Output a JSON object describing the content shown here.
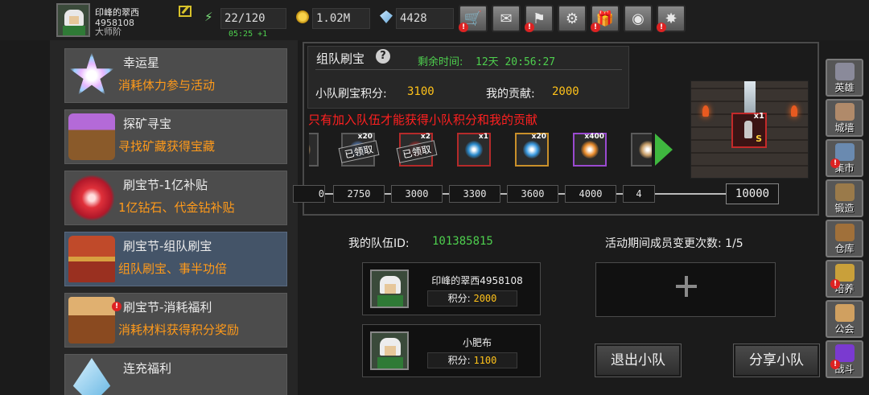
{
  "player": {
    "name": "印峰的翠西",
    "id": "4958108",
    "rank": "大师阶"
  },
  "resources": {
    "energy": "22/120",
    "energy_timer": "05:25 +1",
    "gold": "1.02M",
    "gems": "4428"
  },
  "top_buttons": [
    {
      "icon": "shop-cart-icon",
      "glyph": "🛒",
      "badge": true
    },
    {
      "icon": "mail-icon",
      "glyph": "✉",
      "badge": false
    },
    {
      "icon": "pennant-icon",
      "glyph": "⚑",
      "badge": true
    },
    {
      "icon": "gear-icon",
      "glyph": "⚙",
      "badge": false
    },
    {
      "icon": "gift-icon",
      "glyph": "🎁",
      "badge": true
    },
    {
      "icon": "color-wheel-icon",
      "glyph": "◉",
      "badge": false
    },
    {
      "icon": "fireworks-icon",
      "glyph": "✸",
      "badge": true
    }
  ],
  "menu": {
    "items": [
      {
        "title": "幸运星",
        "subtitle": "消耗体力参与活动",
        "icon": "lucky-star-icon",
        "active": false,
        "badge": false
      },
      {
        "title": "探矿寻宝",
        "subtitle": "寻找矿藏获得宝藏",
        "icon": "mining-cart-icon",
        "active": false,
        "badge": false
      },
      {
        "title": "刷宝节-1亿补贴",
        "subtitle": "1亿钻石、代金钻补贴",
        "icon": "red-flower-icon",
        "active": false,
        "badge": false
      },
      {
        "title": "刷宝节-组队刷宝",
        "subtitle": "组队刷宝、事半功倍",
        "icon": "treasure-chest-icon",
        "active": true,
        "badge": false
      },
      {
        "title": "刷宝节-消耗福利",
        "subtitle": "消耗材料获得积分奖励",
        "icon": "open-chest-icon",
        "active": false,
        "badge": true
      },
      {
        "title": "连充福利",
        "subtitle": "",
        "icon": "crystal-icon",
        "active": false,
        "badge": false
      }
    ]
  },
  "event": {
    "title": "组队刷宝",
    "help": "?",
    "remaining_label": "剩余时间:",
    "remaining_value": "12天 20:56:27",
    "team_score_label": "小队刷宝积分:",
    "team_score_value": "3100",
    "my_contribution_label": "我的贡献:",
    "my_contribution_value": "2000",
    "notice": "只有加入队伍才能获得小队积分和我的贡献",
    "claimed_text": "已领取",
    "rewards": [
      {
        "icon": "partial-item-icon",
        "qty": "",
        "claimed": true,
        "color": "#c9a06a"
      },
      {
        "icon": "dark-gem-icon",
        "qty": "x20",
        "claimed": true,
        "color": "#4a6a9a"
      },
      {
        "icon": "red-rune-icon",
        "qty": "x2",
        "claimed": true,
        "color": "#8a2a2a"
      },
      {
        "icon": "blue-orb-icon",
        "qty": "x1",
        "claimed": false,
        "color": "#2a8acc"
      },
      {
        "icon": "lightning-scroll-icon",
        "qty": "x20",
        "claimed": false,
        "color": "#3a9ae0"
      },
      {
        "icon": "fire-potion-icon",
        "qty": "x400",
        "claimed": false,
        "color": "#e88a2a"
      },
      {
        "icon": "partial-item-icon",
        "qty": "",
        "claimed": false,
        "color": "#c9a06a"
      }
    ],
    "milestones": [
      "0",
      "2750",
      "3000",
      "3300",
      "3600",
      "4000",
      "4"
    ],
    "milestone_final": "10000",
    "preview_item_qty": "x1",
    "preview_item_rarity": "S"
  },
  "team": {
    "id_label": "我的队伍ID:",
    "id_value": "101385815",
    "changes_label": "活动期间成员变更次数:",
    "changes_value": "1/5",
    "score_label": "积分:",
    "members": [
      {
        "name": "印峰的翠西4958108",
        "score": "2000"
      },
      {
        "name": "小肥布",
        "score": "1100"
      }
    ],
    "leave_button": "退出小队",
    "share_button": "分享小队"
  },
  "sidebar": [
    {
      "label": "英雄",
      "icon": "helmet-icon",
      "color": "#8a8a9a",
      "badge": false
    },
    {
      "label": "城墙",
      "icon": "castle-wall-icon",
      "color": "#b08a6a",
      "badge": false
    },
    {
      "label": "集市",
      "icon": "market-stall-icon",
      "color": "#6a8ab0",
      "badge": true
    },
    {
      "label": "锻造",
      "icon": "anvil-icon",
      "color": "#9a7a4a",
      "badge": false
    },
    {
      "label": "仓库",
      "icon": "warehouse-icon",
      "color": "#a0703a",
      "badge": false
    },
    {
      "label": "培养",
      "icon": "trophy-icon",
      "color": "#c9a03a",
      "badge": true
    },
    {
      "label": "公会",
      "icon": "guild-crest-icon",
      "color": "#d0a060",
      "badge": false
    },
    {
      "label": "战斗",
      "icon": "battle-portal-icon",
      "color": "#7a3ad0",
      "badge": true
    }
  ]
}
